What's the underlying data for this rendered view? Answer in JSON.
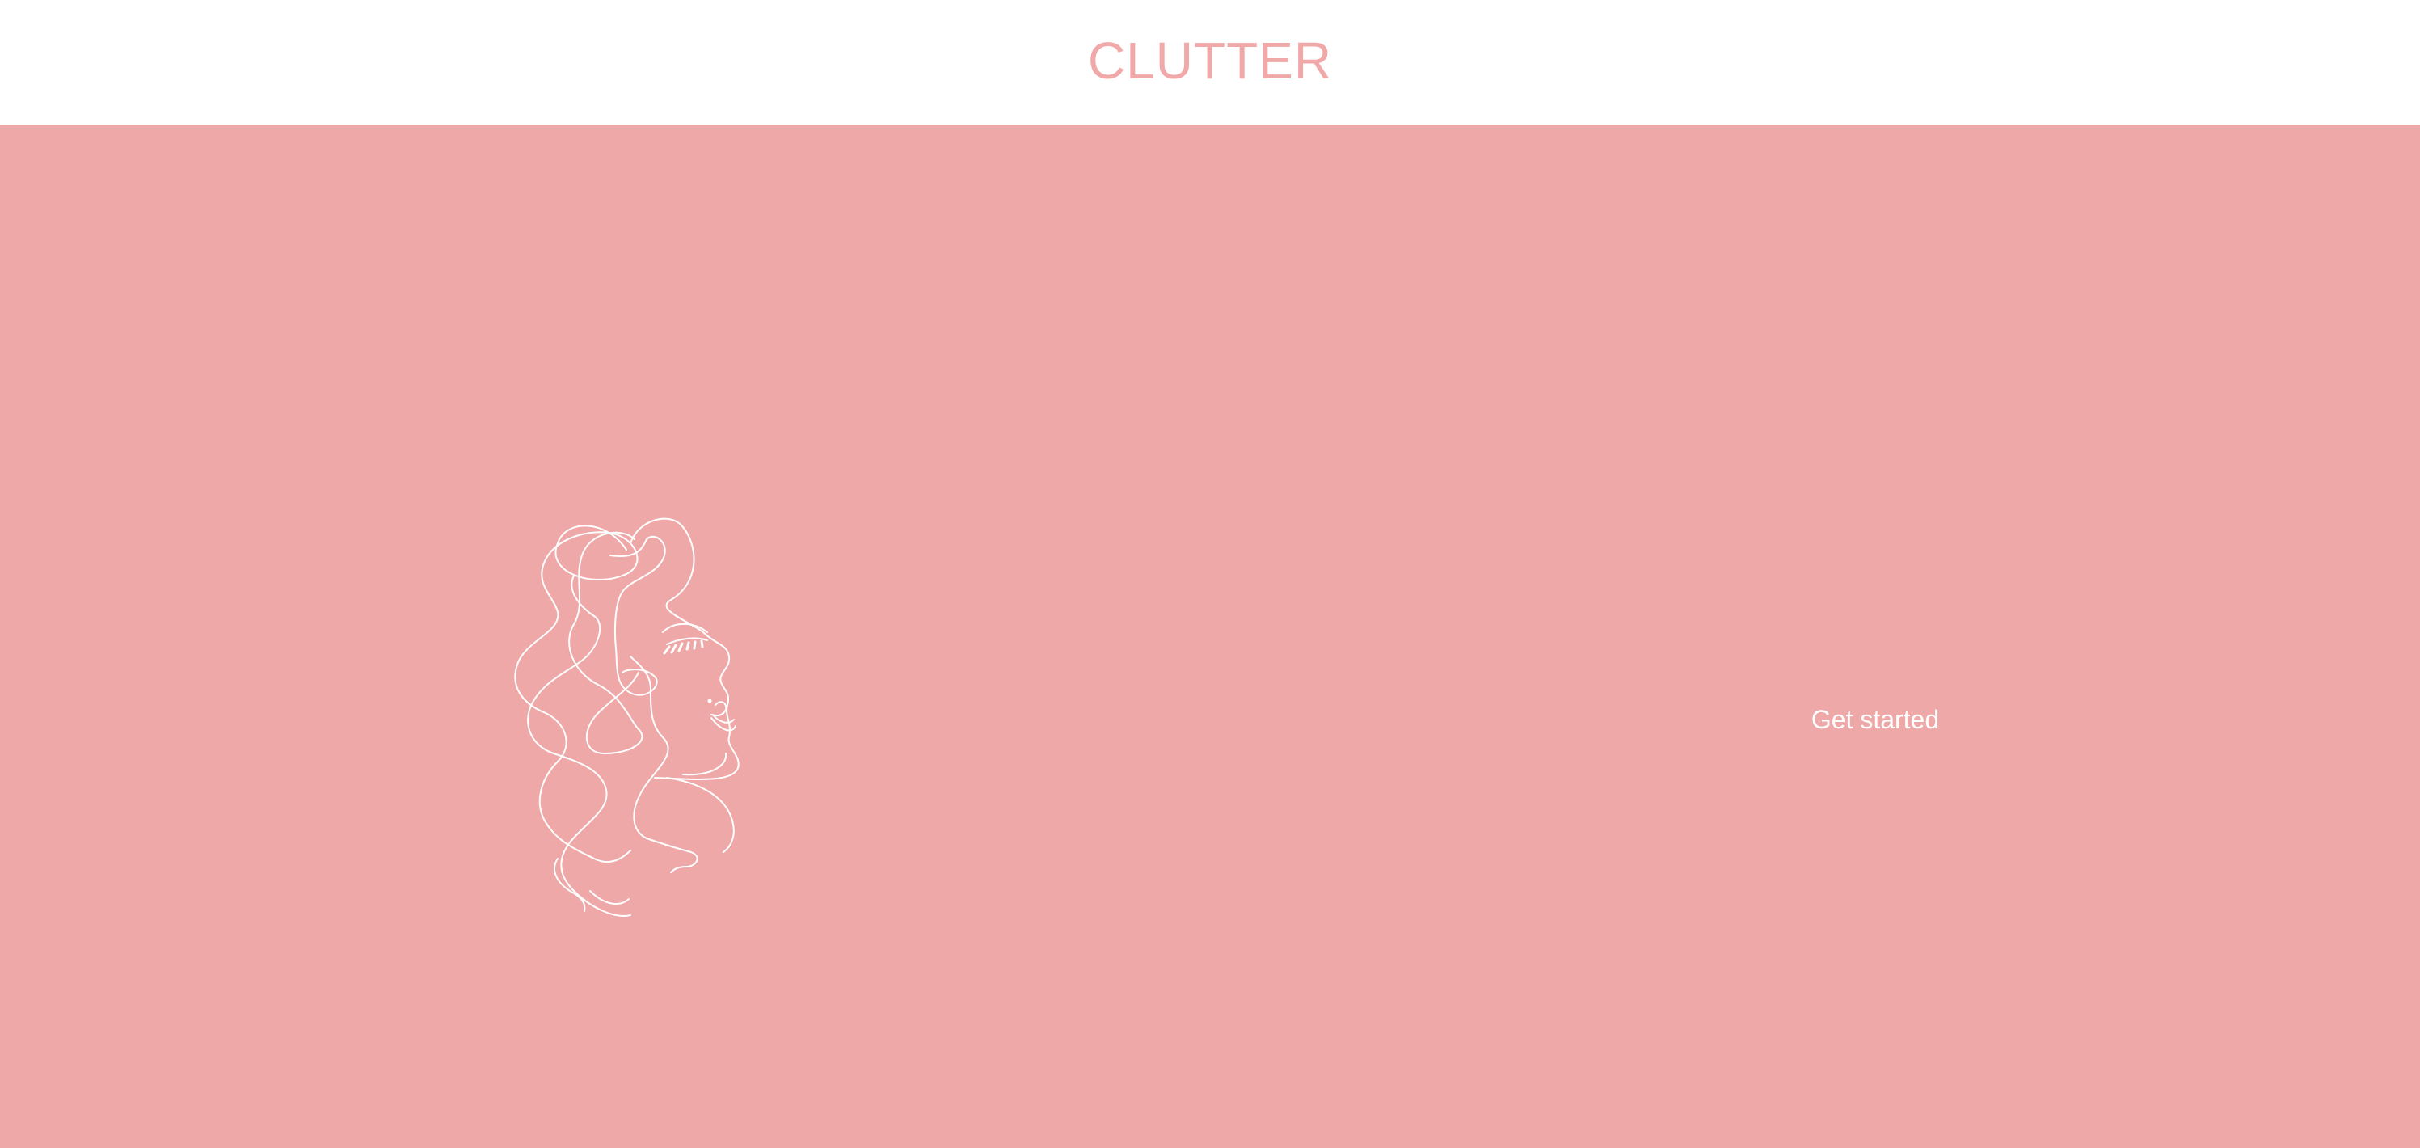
{
  "header": {
    "brand": "CLUTTER"
  },
  "hero": {
    "illustration_name": "woman-face-line-art",
    "cta_label": "Get started"
  },
  "colors": {
    "brand_pink": "#f0a8a8",
    "hero_background": "#efa8a8",
    "header_background": "#ffffff",
    "line_art": "#ffffff"
  }
}
